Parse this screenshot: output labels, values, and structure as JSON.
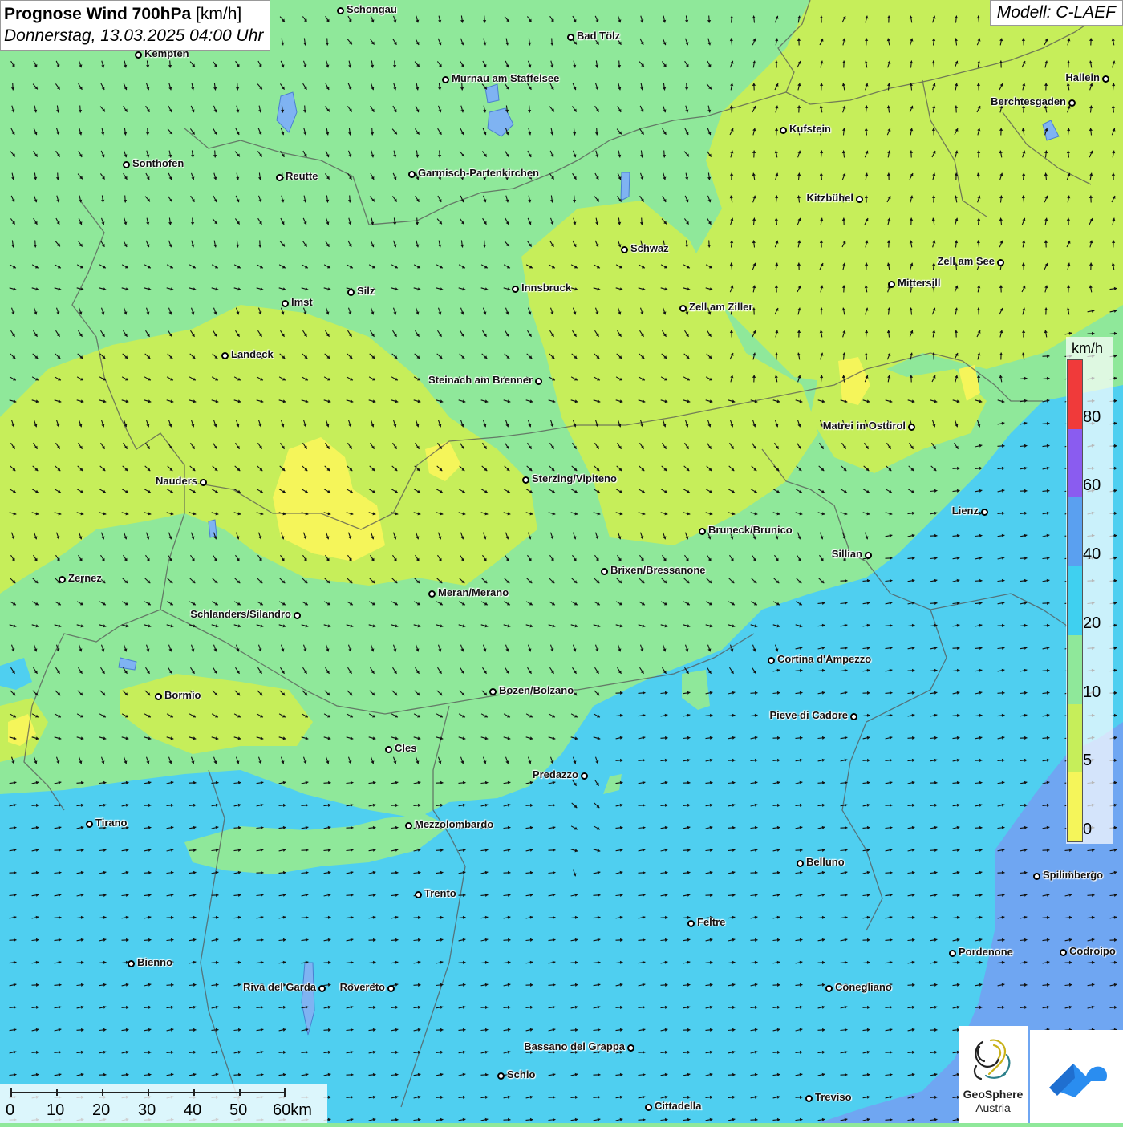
{
  "header": {
    "title_bold": "Prognose Wind 700hPa",
    "title_unit": "[km/h]",
    "subtitle": "Donnerstag, 13.03.2025 04:00 Uhr",
    "model": "Modell: C-LAEF"
  },
  "legend": {
    "unit": "km/h",
    "ticks": [
      "0",
      "5",
      "10",
      "20",
      "40",
      "60",
      "80"
    ],
    "colors": [
      "#f5f55a",
      "#c6ee5a",
      "#8fe89a",
      "#3fd0f0",
      "#5aa0f0",
      "#8a5cf0",
      "#f03a3a"
    ]
  },
  "scale": {
    "labels": [
      "0",
      "10",
      "20",
      "30",
      "40",
      "50",
      "60km"
    ]
  },
  "logo": {
    "name_line1": "GeoSphere",
    "name_line2": "Austria"
  },
  "colors": {
    "calm_yellow": "#f5f55a",
    "light_wind": "#c6ee5a",
    "moderate_green": "#8fe89a",
    "fresh_cyan": "#4fcff0",
    "strong_blue": "#6fa6f2",
    "brand_blue": "#2a8df0"
  },
  "cities": [
    {
      "name": "Schongau"
    },
    {
      "name": "Bad Tölz"
    },
    {
      "name": "Kempten"
    },
    {
      "name": "Murnau am Staffelsee"
    },
    {
      "name": "Hallein"
    },
    {
      "name": "Berchtesgaden"
    },
    {
      "name": "Kufstein"
    },
    {
      "name": "Sonthofen"
    },
    {
      "name": "Reutte"
    },
    {
      "name": "Garmisch-Partenkirchen"
    },
    {
      "name": "Kitzbühel"
    },
    {
      "name": "Schwaz"
    },
    {
      "name": "Zell am See"
    },
    {
      "name": "Mittersill"
    },
    {
      "name": "Innsbruck"
    },
    {
      "name": "Silz"
    },
    {
      "name": "Imst"
    },
    {
      "name": "Zell am Ziller"
    },
    {
      "name": "Landeck"
    },
    {
      "name": "Steinach am Brenner"
    },
    {
      "name": "Matrei in Osttirol"
    },
    {
      "name": "Nauders"
    },
    {
      "name": "Sterzing/Vipiteno"
    },
    {
      "name": "Lienz"
    },
    {
      "name": "Bruneck/Brunico"
    },
    {
      "name": "Sillian"
    },
    {
      "name": "Brixen/Bressanone"
    },
    {
      "name": "Zernez"
    },
    {
      "name": "Meran/Merano"
    },
    {
      "name": "Schlanders/Silandro"
    },
    {
      "name": "Cortina d'Ampezzo"
    },
    {
      "name": "Bozen/Bolzano"
    },
    {
      "name": "Bormio"
    },
    {
      "name": "Pieve di Cadore"
    },
    {
      "name": "Cles"
    },
    {
      "name": "Predazzo"
    },
    {
      "name": "Tirano"
    },
    {
      "name": "Mezzolombardo"
    },
    {
      "name": "Belluno"
    },
    {
      "name": "Spilimbergo"
    },
    {
      "name": "Trento"
    },
    {
      "name": "Feltre"
    },
    {
      "name": "Pordenone"
    },
    {
      "name": "Codroipo"
    },
    {
      "name": "Bienno"
    },
    {
      "name": "Riva del Garda"
    },
    {
      "name": "Rovereto"
    },
    {
      "name": "Conegliano"
    },
    {
      "name": "Bassano del Grappa"
    },
    {
      "name": "Schio"
    },
    {
      "name": "Treviso"
    },
    {
      "name": "Cittadella"
    }
  ]
}
